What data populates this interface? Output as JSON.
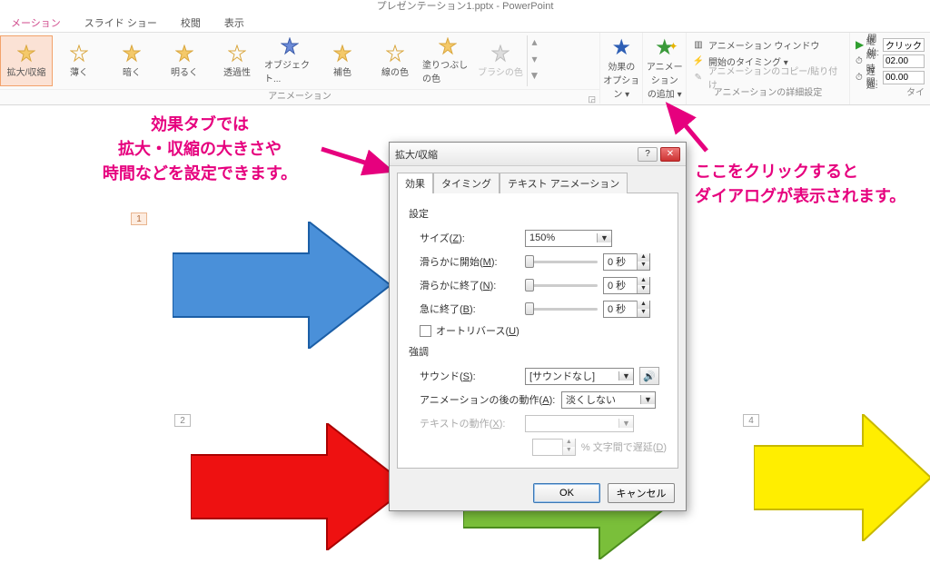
{
  "title": "プレゼンテーション1.pptx - PowerPoint",
  "tabs": {
    "t0": "メーション",
    "t1": "スライド ショー",
    "t2": "校閲",
    "t3": "表示"
  },
  "gallery": {
    "items": [
      "拡大/収縮",
      "薄く",
      "暗く",
      "明るく",
      "透過性",
      "オブジェクト...",
      "補色",
      "線の色",
      "塗りつぶしの色",
      "ブラシの色"
    ],
    "group_label": "アニメーション"
  },
  "effect_options": {
    "label1": "効果の",
    "label2": "オプション ▾"
  },
  "add_anim": {
    "label1": "アニメーション",
    "label2": "の追加 ▾"
  },
  "adv": {
    "r1": "アニメーション ウィンドウ",
    "r2": "開始のタイミング ▾",
    "r3": "アニメーションのコピー/貼り付け",
    "group_label": "アニメーションの詳細設定"
  },
  "timing": {
    "start_lbl": "開始:",
    "start_val": "クリック時",
    "dur_lbl": "継続時間:",
    "dur_val": "02.00",
    "delay_lbl": "遅延:",
    "delay_val": "00.00",
    "group_label": "タイ"
  },
  "annotation1": "効果タブでは\n拡大・収縮の大きさや\n時間などを設定できます。",
  "annotation2": "ここをクリックすると\nダイアログが表示されます。",
  "slide_nums": {
    "n1": "1",
    "n2": "2",
    "n4": "4"
  },
  "dialog": {
    "title": "拡大/収縮",
    "tabs": {
      "t0": "効果",
      "t1": "タイミング",
      "t2": "テキスト アニメーション"
    },
    "sec_settings": "設定",
    "size_lbl": "サイズ(",
    "size_u": "Z",
    "size_end": "):",
    "size_val": "150%",
    "smooth_start_lbl": "滑らかに開始(",
    "smooth_start_u": "M",
    "smooth_start_val": "0 秒",
    "smooth_end_lbl": "滑らかに終了(",
    "smooth_end_u": "N",
    "smooth_end_val": "0 秒",
    "bounce_lbl": "急に終了(",
    "bounce_u": "B",
    "bounce_val": "0 秒",
    "autorev_lbl": "オートリバース(",
    "autorev_u": "U",
    "sec_emph": "強調",
    "sound_lbl": "サウンド(",
    "sound_u": "S",
    "sound_val": "[サウンドなし]",
    "after_lbl": "アニメーションの後の動作(",
    "after_u": "A",
    "after_val": "淡くしない",
    "text_lbl": "テキストの動作(",
    "text_u": "X",
    "delay_letters": "% 文字間で遅延(",
    "delay_letters_u": "D",
    "paren_close": ")",
    "colon": ":",
    "ok": "OK",
    "cancel": "キャンセル"
  }
}
